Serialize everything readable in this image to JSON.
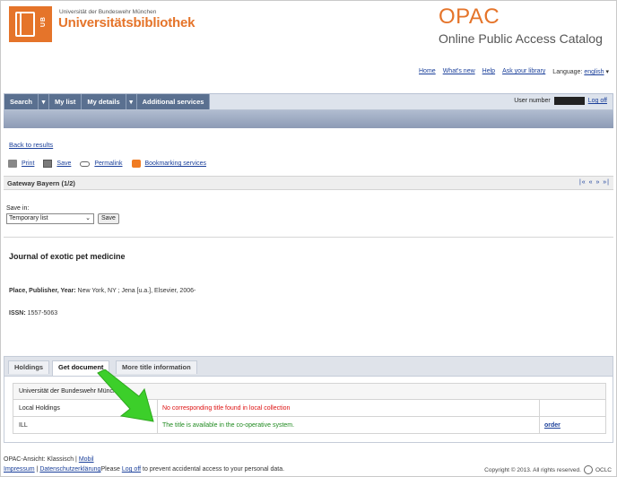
{
  "header": {
    "university_small": "Universität der Bundeswehr München",
    "university_name": "Universitätsbibliothek",
    "logo_text": "UB",
    "opac_title": "OPAC",
    "opac_subtitle": "Online Public Access Catalog"
  },
  "topnav": {
    "home": "Home",
    "whats_new": "What's new",
    "help": "Help",
    "ask": "Ask your library",
    "language_label": "Language:",
    "language_value": "english"
  },
  "menu": {
    "search": "Search",
    "search_drop": "▾",
    "my_list": "My list",
    "my_details": "My details",
    "details_drop": "▾",
    "additional": "Additional services",
    "user_number_label": "User number",
    "logoff": "Log off"
  },
  "back_link": "Back to results",
  "tools": {
    "print": "Print",
    "save": "Save",
    "permalink": "Permalink",
    "bookmarking": "Bookmarking services"
  },
  "gateway": {
    "title": "Gateway Bayern (1/2)",
    "pager": "|« « » »|"
  },
  "save_in": {
    "label": "Save in:",
    "selected": "Temporary list",
    "button": "Save"
  },
  "record": {
    "title": "Journal of exotic pet medicine",
    "publisher_label": "Place, Publisher, Year:",
    "publisher_value": "New York, NY ; Jena [u.a.], Elsevier, 2006-",
    "issn_label": "ISSN:",
    "issn_value": "1557-5063"
  },
  "subtabs": {
    "holdings": "Holdings",
    "get_document": "Get document",
    "more_info": "More title information"
  },
  "holdings_table": {
    "header": "Universität der Bundeswehr München",
    "rows": [
      {
        "label": "Local Holdings",
        "status": "No corresponding title found in local collection",
        "action": ""
      },
      {
        "label": "ILL",
        "status": "The title is available in the co-operative system.",
        "action": "order"
      }
    ]
  },
  "footer": {
    "view_label": "OPAC-Ansicht:",
    "classic": "Klassisch",
    "sep": "|",
    "mobile": "Mobil",
    "impressum": "Impressum",
    "privacy": "Datenschutzerklärung",
    "please": "Please",
    "logoff": "Log off",
    "privacy_note": "to prevent accidental access to your personal data.",
    "copyright": "Copyright © 2013. All rights reserved.",
    "oclc": "OCLC"
  },
  "colors": {
    "brand_orange": "#e5742a",
    "menu_blue": "#5a7090",
    "link_blue": "#1a3f9a",
    "error_red": "#dd1111",
    "success_green": "#1f8a1f",
    "arrow_green": "#3ccf2a"
  }
}
